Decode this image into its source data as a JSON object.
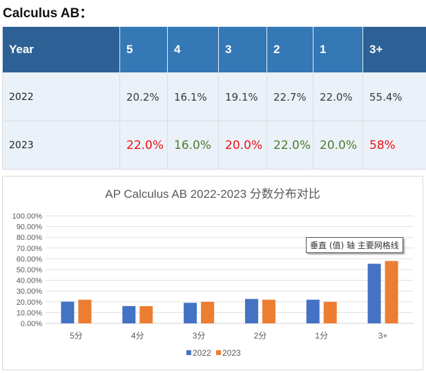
{
  "heading": "Calculus AB：",
  "table": {
    "headers": [
      "Year",
      "5",
      "4",
      "3",
      "2",
      "1",
      "3+"
    ],
    "rows": [
      {
        "year": "2022",
        "cells": [
          {
            "text": "20.2%",
            "color": "normal"
          },
          {
            "text": "16.1%",
            "color": "normal"
          },
          {
            "text": "19.1%",
            "color": "normal"
          },
          {
            "text": "22.7%",
            "color": "normal"
          },
          {
            "text": "22.0%",
            "color": "normal"
          },
          {
            "text": "55.4%",
            "color": "normal"
          }
        ]
      },
      {
        "year": "2023",
        "cells": [
          {
            "text": "22.0%",
            "color": "red"
          },
          {
            "text": "16.0%",
            "color": "green"
          },
          {
            "text": "20.0%",
            "color": "red"
          },
          {
            "text": "22.0%",
            "color": "green"
          },
          {
            "text": "20.0%",
            "color": "green"
          },
          {
            "text": "58%",
            "color": "red"
          }
        ]
      }
    ]
  },
  "colors": {
    "header_blue": "#3478b6",
    "header_dark": "#2d6196",
    "row_bg": "#ebf1f9",
    "increase_red": "#ee1111",
    "decrease_green": "#4a7d2c"
  },
  "tooltip": "垂直 (值) 轴 主要网格线",
  "chart_data": {
    "type": "bar",
    "title": "AP Calculus AB 2022-2023 分数分布对比",
    "categories": [
      "5分",
      "4分",
      "3分",
      "2分",
      "1分",
      "3+"
    ],
    "series": [
      {
        "name": "2022",
        "color": "#4472c4",
        "values": [
          0.202,
          0.161,
          0.191,
          0.227,
          0.22,
          0.554
        ]
      },
      {
        "name": "2023",
        "color": "#ed7d31",
        "values": [
          0.22,
          0.16,
          0.2,
          0.22,
          0.2,
          0.58
        ]
      }
    ],
    "ylim": [
      0,
      1.0
    ],
    "yticks": [
      0,
      0.1,
      0.2,
      0.3,
      0.4,
      0.5,
      0.6,
      0.7,
      0.8,
      0.9,
      1.0
    ],
    "ytick_labels": [
      "0.00%",
      "10.00%",
      "20.00%",
      "30.00%",
      "40.00%",
      "50.00%",
      "60.00%",
      "70.00%",
      "80.00%",
      "90.00%",
      "100.00%"
    ],
    "xlabel": "",
    "ylabel": "",
    "grid": true,
    "legend": "bottom"
  }
}
